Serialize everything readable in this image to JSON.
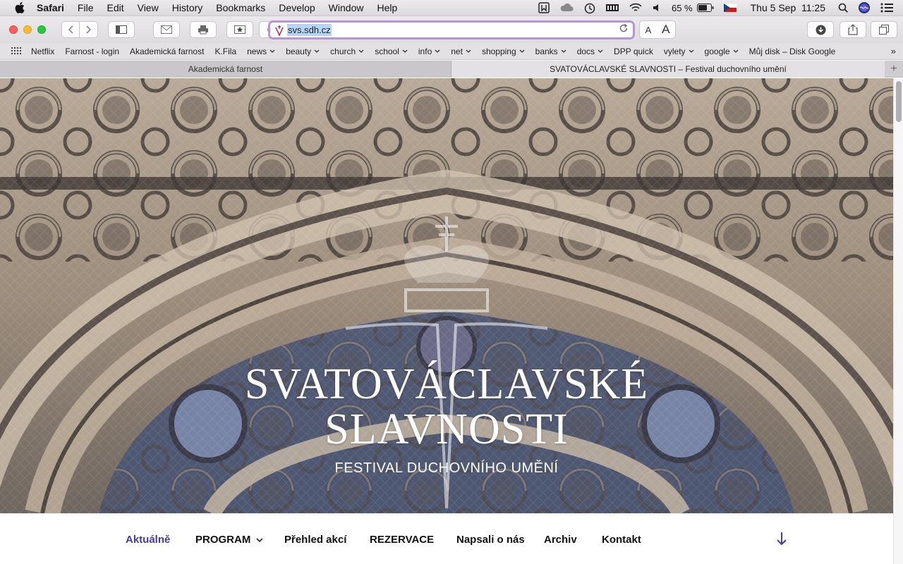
{
  "menubar": {
    "app": "Safari",
    "menus": [
      "File",
      "Edit",
      "View",
      "History",
      "Bookmarks",
      "Develop",
      "Window",
      "Help"
    ],
    "battery": "65 %",
    "datetime": "Thu 5 Sep  11:25"
  },
  "address": {
    "url": "svs.sdh.cz"
  },
  "bookmarks": [
    {
      "label": "Netflix",
      "menu": false
    },
    {
      "label": "Farnost - login",
      "menu": false
    },
    {
      "label": "Akademická farnost",
      "menu": false
    },
    {
      "label": "K.Fila",
      "menu": false
    },
    {
      "label": "news",
      "menu": true
    },
    {
      "label": "beauty",
      "menu": true
    },
    {
      "label": "church",
      "menu": true
    },
    {
      "label": "school",
      "menu": true
    },
    {
      "label": "info",
      "menu": true
    },
    {
      "label": "net",
      "menu": true
    },
    {
      "label": "shopping",
      "menu": true
    },
    {
      "label": "banks",
      "menu": true
    },
    {
      "label": "docs",
      "menu": true
    },
    {
      "label": "DPP quick",
      "menu": false
    },
    {
      "label": "vylety",
      "menu": true
    },
    {
      "label": "google",
      "menu": true
    },
    {
      "label": "Můj disk – Disk Google",
      "menu": false
    }
  ],
  "tabs": {
    "tab1": "Akademická farnost",
    "tab2": "SVATOVÁCLAVSKÉ SLAVNOSTI – Festival duchovního umění"
  },
  "hero": {
    "title_line1": "SVATOVÁCLAVSKÉ",
    "title_line2": "SLAVNOSTI",
    "subtitle": "FESTIVAL DUCHOVNÍHO UMĚNÍ"
  },
  "nav": {
    "aktualne": "Aktuálně",
    "program": "PROGRAM",
    "prehled": "Přehled akcí",
    "rezervace": "REZERVACE",
    "napsali": "Napsali o nás",
    "archiv": "Archiv",
    "kontakt": "Kontakt"
  },
  "colors": {
    "accent": "#4b3aa3",
    "address_focus": "#b894d4"
  }
}
